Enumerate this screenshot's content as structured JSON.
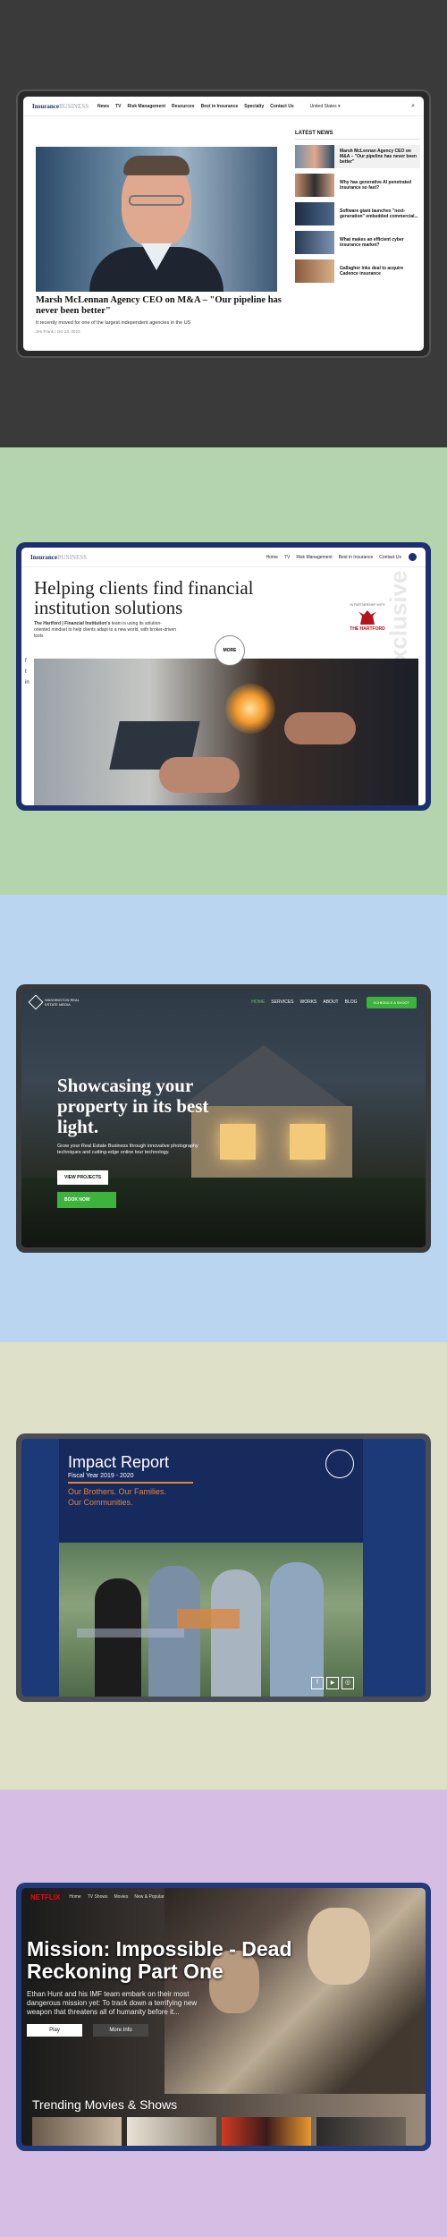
{
  "colors": {
    "band1": "#3a3a3a",
    "band2": "#b3d4ad",
    "band3": "#b9d5ef",
    "band4": "#dfe0c8",
    "band5": "#d6bde4",
    "navy": "#1d2f6f",
    "green": "#3db33d",
    "red": "#e50914"
  },
  "s1": {
    "logo_a": "Insurance",
    "logo_b": "BUSINESS",
    "nav": [
      "News",
      "TV",
      "Risk Management",
      "Resources",
      "Best in Insurance",
      "Specialty",
      "Contact Us"
    ],
    "region": "United States ▾",
    "headline": "Marsh McLennan Agency CEO on M&A – \"Our pipeline has never been better\"",
    "subhead": "It recently moved for one of the largest independent agencies in the US",
    "byline": "Jen Frank  |  Oct 23, 2023",
    "latest_title": "LATEST NEWS",
    "latest": [
      "Marsh McLennan Agency CEO on M&A – \"Our pipeline has never been better\"",
      "Why has generative AI penetrated insurance so fast?",
      "Software giant launches \"next-generation\" embedded commercial...",
      "What makes an efficient cyber insurance market?",
      "Gallagher inks deal to acquire Cadence insurance"
    ]
  },
  "s2": {
    "logo_a": "Insurance",
    "logo_b": "BUSINESS",
    "nav": [
      "Home",
      "TV",
      "Risk Management",
      "Best in Insurance",
      "Contact Us"
    ],
    "heading": "Helping clients find financial institution solutions",
    "body_bold": "The Hartford | Financial Institution's",
    "body": " team is using its solution-oriented mindset to help clients adapt to a new world, with broker-driven tools",
    "more": "MORE",
    "sponsor_label": "IN PARTNERSHIP WITH",
    "sponsor": "THE HARTFORD",
    "side_word": "Exclusive"
  },
  "s3": {
    "brand": "WASHINGTON REAL ESTATE MEDIA",
    "nav": [
      "HOME",
      "SERVICES",
      "WORKS",
      "ABOUT",
      "BLOG"
    ],
    "cta": "SCHEDULE A SHOOT",
    "heading": "Showcasing your property in its best light.",
    "body": "Grow your Real Estate Business through innovative photography techniques and cutting-edge online tour technology.",
    "btn1": "VIEW PROJECTS",
    "btn2": "BOOK NOW"
  },
  "s4": {
    "title": "Impact Report",
    "fiscal": "Fiscal Year 2019 - 2020",
    "tagline": [
      "Our Brothers. Our Families.",
      "Our Communities."
    ],
    "social": [
      "f",
      "▶",
      "◎"
    ]
  },
  "s5": {
    "logo": "NETFLIX",
    "nav": [
      "Home",
      "TV Shows",
      "Movies",
      "New & Popular"
    ],
    "title": "Mission: Impossible - Dead Reckoning Part One",
    "desc": "Ethan Hunt and his IMF team embark on their most dangerous mission yet: To track down a terrifying new weapon that threatens all of humanity before it...",
    "play": "Play",
    "more": "More Info",
    "row_title": "Trending Movies & Shows"
  }
}
